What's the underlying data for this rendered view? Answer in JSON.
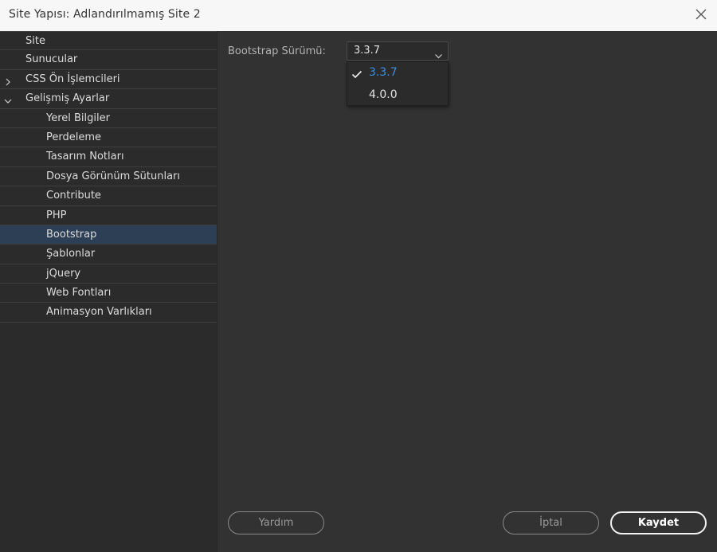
{
  "window": {
    "title": "Site Yapısı: Adlandırılmamış Site 2",
    "close_icon": "close-icon"
  },
  "sidebar": {
    "items": [
      {
        "label": "Site",
        "level": 0
      },
      {
        "label": "Sunucular",
        "level": 0
      },
      {
        "label": "CSS Ön İşlemcileri",
        "level": 0,
        "expander": "chevron-right-icon"
      },
      {
        "label": "Gelişmiş Ayarlar",
        "level": 0,
        "expander": "chevron-down-icon"
      },
      {
        "label": "Yerel Bilgiler",
        "level": 1
      },
      {
        "label": "Perdeleme",
        "level": 1
      },
      {
        "label": "Tasarım Notları",
        "level": 1
      },
      {
        "label": "Dosya Görünüm Sütunları",
        "level": 1
      },
      {
        "label": "Contribute",
        "level": 1
      },
      {
        "label": "PHP",
        "level": 1
      },
      {
        "label": "Bootstrap",
        "level": 1,
        "selected": true
      },
      {
        "label": "Şablonlar",
        "level": 1
      },
      {
        "label": "jQuery",
        "level": 1
      },
      {
        "label": "Web Fontları",
        "level": 1
      },
      {
        "label": "Animasyon Varlıkları",
        "level": 1
      }
    ],
    "selected_color": "#2d3f55"
  },
  "main": {
    "version_label": "Bootstrap Sürümü:",
    "version_select": {
      "value": "3.3.7",
      "options": [
        "3.3.7",
        "4.0.0"
      ],
      "active_color": "#3a8ee6"
    }
  },
  "footer": {
    "help_label": "Yardım",
    "cancel_label": "İptal",
    "save_label": "Kaydet"
  }
}
